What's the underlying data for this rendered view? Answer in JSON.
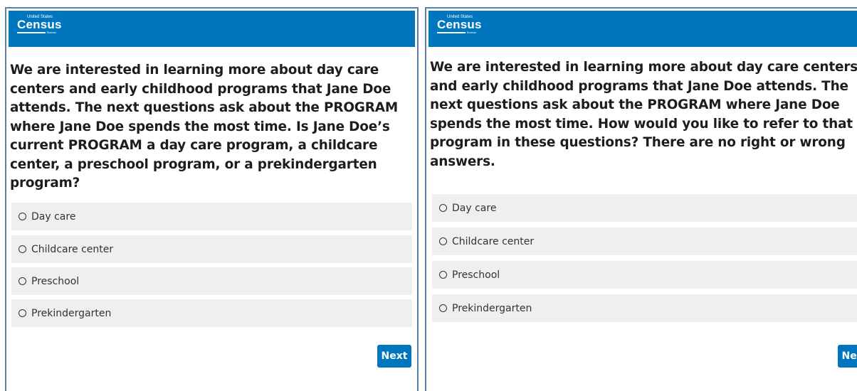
{
  "logo": {
    "small": "United States",
    "big": "Census",
    "bureau": "Bureau"
  },
  "left": {
    "question": "We are interested in learning more about day care centers and early childhood programs that Jane Doe attends. The next questions ask about the PROGRAM where Jane Doe spends the most time.  Is Jane Doe’s current PROGRAM a day care program, a childcare center, a preschool program, or a prekindergarten program?",
    "options": [
      "Day care",
      "Childcare center",
      "Preschool",
      "Prekindergarten"
    ],
    "next_label": "Next"
  },
  "right": {
    "question": "We are interested in learning more about day care centers and early childhood programs that Jane Doe attends. The next questions ask about the PROGRAM where Jane Doe spends the most time.  How would you like to refer to that program in these questions? There are no right or wrong answers.",
    "options": [
      "Day care",
      "Childcare center",
      "Preschool",
      "Prekindergarten"
    ],
    "next_label": "Next"
  },
  "colors": {
    "header_blue": "#0076bf",
    "option_bg": "#efefef",
    "panel_border": "#5b7fa8"
  }
}
